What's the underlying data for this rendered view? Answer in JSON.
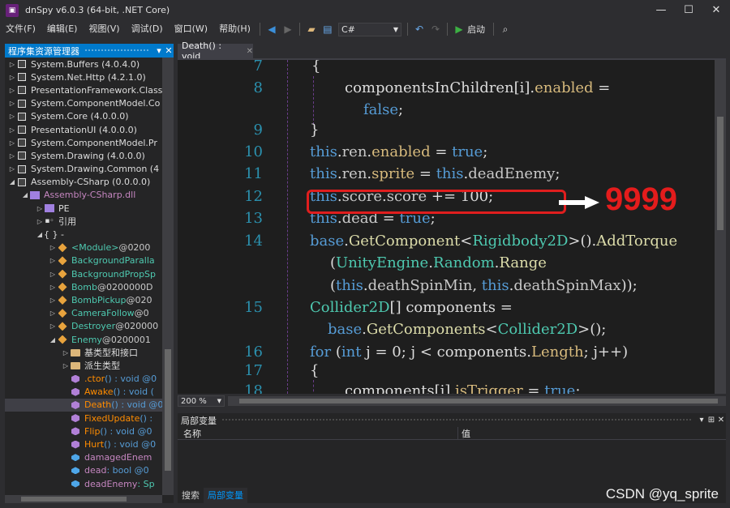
{
  "window": {
    "title": "dnSpy v6.0.3 (64-bit, .NET Core)",
    "minimize": "—",
    "maximize": "☐",
    "close": "✕"
  },
  "menu": {
    "items": [
      "文件(F)",
      "编辑(E)",
      "视图(V)",
      "调试(D)",
      "窗口(W)",
      "帮助(H)"
    ]
  },
  "toolbar": {
    "language": "C#",
    "start_label": "启动"
  },
  "assembly_explorer": {
    "title": "程序集资源管理器",
    "items": [
      {
        "text": "System.Buffers (4.0.4.0)"
      },
      {
        "text": "System.Net.Http (4.2.1.0)"
      },
      {
        "text": "PresentationFramework.Classic"
      },
      {
        "text": "System.ComponentModel.Co"
      },
      {
        "text": "System.Core (4.0.0.0)"
      },
      {
        "text": "PresentationUI (4.0.0.0)"
      },
      {
        "text": "System.ComponentModel.Pr"
      },
      {
        "text": "System.Drawing (4.0.0.0)"
      },
      {
        "text": "System.Drawing.Common (4"
      },
      {
        "text": "Assembly-CSharp (0.0.0.0)"
      },
      {
        "text": "Assembly-CSharp.dll"
      },
      {
        "text": "PE"
      },
      {
        "text": "引用"
      },
      {
        "text": "{ } -"
      },
      {
        "text": "<Module>",
        "suffix": " @0200"
      },
      {
        "text": "BackgroundParalla"
      },
      {
        "text": "BackgroundPropSp"
      },
      {
        "text": "Bomb",
        "suffix": " @0200000D"
      },
      {
        "text": "BombPickup",
        "suffix": " @020"
      },
      {
        "text": "CameraFollow",
        "suffix": " @0"
      },
      {
        "text": "Destroyer",
        "suffix": " @020000"
      },
      {
        "text": "Enemy",
        "suffix": " @0200001"
      },
      {
        "text": "基类型和接口"
      },
      {
        "text": "派生类型"
      },
      {
        "text": ".ctor",
        "suffix": "() : void @0"
      },
      {
        "text": "Awake",
        "suffix": "() : void ("
      },
      {
        "text": "Death",
        "suffix": "() : void @0"
      },
      {
        "text": "FixedUpdate",
        "suffix": "() :"
      },
      {
        "text": "Flip",
        "suffix": "() : void @0"
      },
      {
        "text": "Hurt",
        "suffix": "() : void @0"
      },
      {
        "text": "damagedEnem"
      },
      {
        "text": "dead",
        "suffix": " : bool @0"
      },
      {
        "text": "deadEnemy",
        "suffix": " : Sp"
      }
    ]
  },
  "editor": {
    "tab_label": "Death() : void",
    "tab_close": "✕",
    "zoom": "200 %",
    "line_numbers": [
      "7",
      "8",
      "9",
      "10",
      "11",
      "12",
      "13",
      "14",
      "15",
      "16",
      "17",
      "18"
    ],
    "annotation": "9999"
  },
  "locals": {
    "title": "局部变量",
    "col_name": "名称",
    "col_value": "值",
    "tab_search": "搜索",
    "tab_locals": "局部变量"
  },
  "watermark": "CSDN @yq_sprite",
  "colors": {
    "accent": "#007acc",
    "keyword": "#569cd6",
    "type": "#4ec9b0",
    "property": "#d7ba7d",
    "method": "#dcdcaa",
    "highlight_box": "#e01e1e",
    "annotation": "#e41c1c"
  }
}
